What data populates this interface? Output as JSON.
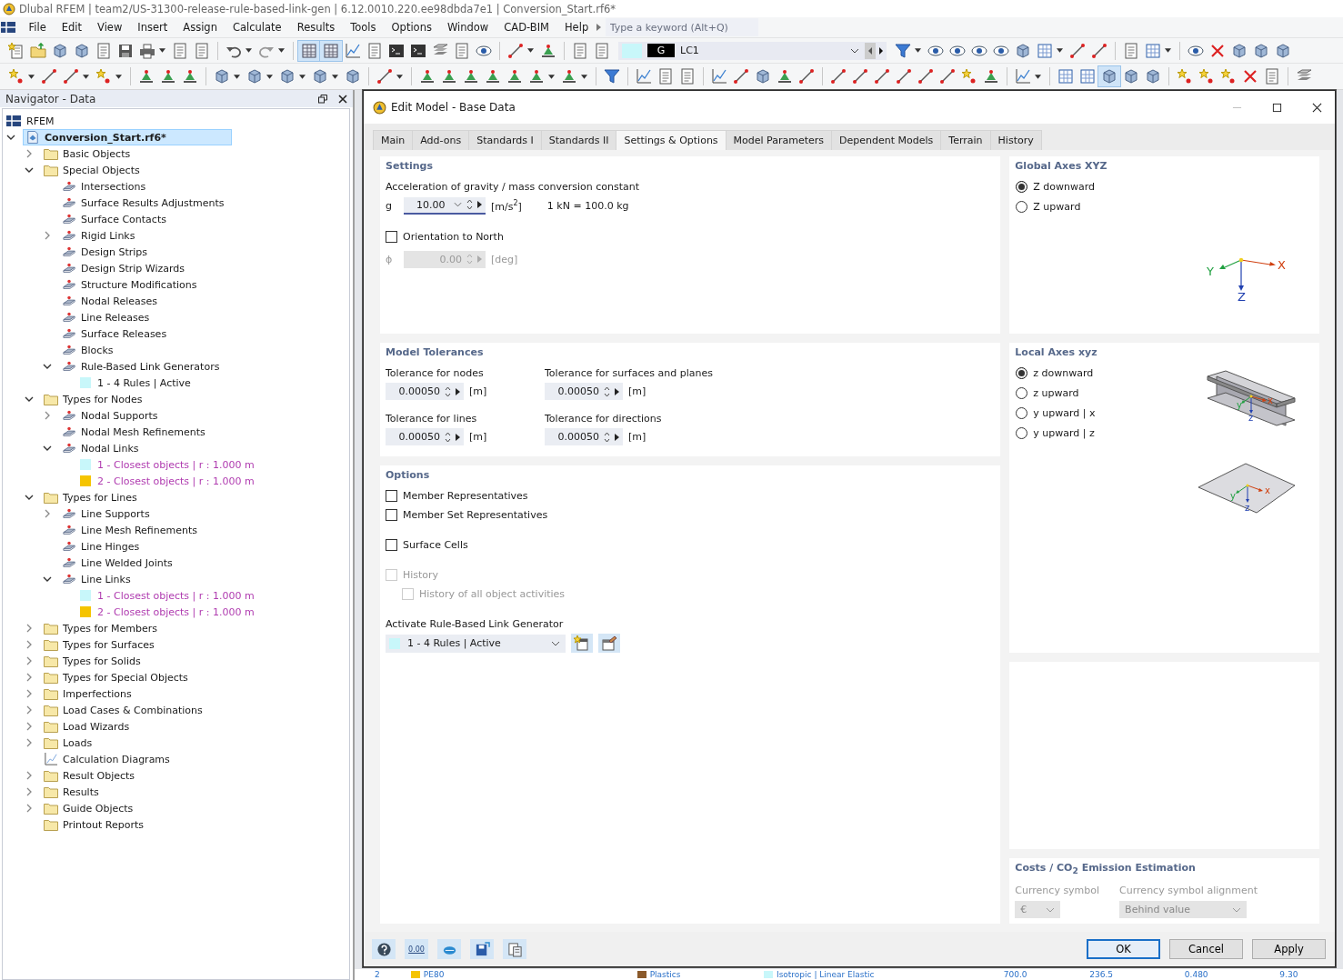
{
  "title_bar": {
    "title": "Dlubal RFEM | team2/US-31300-release-rule-based-link-gen | 6.12.0010.220.ee98dbda7e1 | Conversion_Start.rf6*"
  },
  "menu": [
    "File",
    "Edit",
    "View",
    "Insert",
    "Assign",
    "Calculate",
    "Results",
    "Tools",
    "Options",
    "Window",
    "CAD-BIM",
    "Help"
  ],
  "search": {
    "placeholder": "Type a keyword (Alt+Q)"
  },
  "load_case": {
    "category": "G",
    "name": "LC1"
  },
  "navigator": {
    "title": "Navigator - Data",
    "root": "RFEM",
    "tree": [
      {
        "label": "Conversion_Start.rf6*",
        "kind": "file",
        "selected": true,
        "expanded": true,
        "children": [
          {
            "label": "Basic Objects",
            "kind": "folder",
            "selected": false,
            "expanded": false
          },
          {
            "label": "Special Objects",
            "kind": "folder",
            "selected": false,
            "expanded": true,
            "children": [
              {
                "label": "Intersections",
                "kind": "object",
                "selected": false
              },
              {
                "label": "Surface Results Adjustments",
                "kind": "object",
                "selected": false
              },
              {
                "label": "Surface Contacts",
                "kind": "object",
                "selected": false
              },
              {
                "label": "Rigid Links",
                "kind": "object",
                "selected": false,
                "expanded": false
              },
              {
                "label": "Design Strips",
                "kind": "object",
                "selected": false
              },
              {
                "label": "Design Strip Wizards",
                "kind": "object",
                "selected": false
              },
              {
                "label": "Structure Modifications",
                "kind": "object",
                "selected": false
              },
              {
                "label": "Nodal Releases",
                "kind": "object",
                "selected": false
              },
              {
                "label": "Line Releases",
                "kind": "object",
                "selected": false
              },
              {
                "label": "Surface Releases",
                "kind": "object",
                "selected": false
              },
              {
                "label": "Blocks",
                "kind": "object",
                "selected": false
              },
              {
                "label": "Rule-Based Link Generators",
                "kind": "object",
                "selected": false,
                "expanded": true,
                "children": [
                  {
                    "label": "1 - 4 Rules | Active",
                    "kind": "rule",
                    "selected": false,
                    "color": "#c8f7fa"
                  }
                ]
              }
            ]
          },
          {
            "label": "Types for Nodes",
            "kind": "folder",
            "selected": false,
            "expanded": true,
            "children": [
              {
                "label": "Nodal Supports",
                "kind": "object",
                "selected": false,
                "expanded": false
              },
              {
                "label": "Nodal Mesh Refinements",
                "kind": "object",
                "selected": false
              },
              {
                "label": "Nodal Links",
                "kind": "object",
                "selected": false,
                "expanded": true,
                "children": [
                  {
                    "label": "1 - Closest objects | r : 1.000 m",
                    "kind": "link",
                    "selected": false,
                    "color": "#c8f7fa"
                  },
                  {
                    "label": "2 - Closest objects | r : 1.000 m",
                    "kind": "link",
                    "selected": false,
                    "color": "#f5c400"
                  }
                ]
              }
            ]
          },
          {
            "label": "Types for Lines",
            "kind": "folder",
            "selected": false,
            "expanded": true,
            "children": [
              {
                "label": "Line Supports",
                "kind": "object",
                "selected": false,
                "expanded": false
              },
              {
                "label": "Line Mesh Refinements",
                "kind": "object",
                "selected": false
              },
              {
                "label": "Line Hinges",
                "kind": "object",
                "selected": false
              },
              {
                "label": "Line Welded Joints",
                "kind": "object",
                "selected": false
              },
              {
                "label": "Line Links",
                "kind": "object",
                "selected": false,
                "expanded": true,
                "children": [
                  {
                    "label": "1 - Closest objects | r : 1.000 m",
                    "kind": "link",
                    "selected": false,
                    "color": "#c8f7fa"
                  },
                  {
                    "label": "2 - Closest objects | r : 1.000 m",
                    "kind": "link",
                    "selected": false,
                    "color": "#f5c400"
                  }
                ]
              }
            ]
          },
          {
            "label": "Types for Members",
            "kind": "folder",
            "selected": false,
            "expanded": false
          },
          {
            "label": "Types for Surfaces",
            "kind": "folder",
            "selected": false,
            "expanded": false
          },
          {
            "label": "Types for Solids",
            "kind": "folder",
            "selected": false,
            "expanded": false
          },
          {
            "label": "Types for Special Objects",
            "kind": "folder",
            "selected": false,
            "expanded": false
          },
          {
            "label": "Imperfections",
            "kind": "folder",
            "selected": false,
            "expanded": false
          },
          {
            "label": "Load Cases & Combinations",
            "kind": "folder",
            "selected": false,
            "expanded": false
          },
          {
            "label": "Load Wizards",
            "kind": "folder",
            "selected": false,
            "expanded": false
          },
          {
            "label": "Loads",
            "kind": "folder",
            "selected": false,
            "expanded": false
          },
          {
            "label": "Calculation Diagrams",
            "kind": "diagram",
            "selected": false
          },
          {
            "label": "Result Objects",
            "kind": "folder",
            "selected": false,
            "expanded": false
          },
          {
            "label": "Results",
            "kind": "folder",
            "selected": false,
            "expanded": false
          },
          {
            "label": "Guide Objects",
            "kind": "folder",
            "selected": false,
            "expanded": false
          },
          {
            "label": "Printout Reports",
            "kind": "folder",
            "selected": false
          }
        ]
      }
    ]
  },
  "dialog": {
    "title": "Edit Model - Base Data",
    "tabs": [
      {
        "label": "Main",
        "selected": false
      },
      {
        "label": "Add-ons",
        "selected": false
      },
      {
        "label": "Standards I",
        "selected": false
      },
      {
        "label": "Standards II",
        "selected": false
      },
      {
        "label": "Settings & Options",
        "selected": true
      },
      {
        "label": "Model Parameters",
        "selected": false
      },
      {
        "label": "Dependent Models",
        "selected": false
      },
      {
        "label": "Terrain",
        "selected": false
      },
      {
        "label": "History",
        "selected": false
      }
    ],
    "settings": {
      "title": "Settings",
      "gravity_label": "Acceleration of gravity / mass conversion constant",
      "gravity_symbol": "g",
      "gravity_value": "10.00",
      "gravity_unit": "[m/s$^{2}$]",
      "conversion": "1 kN = 100.0 kg",
      "orientation": {
        "label": "Orientation to North",
        "checked": false
      },
      "angle": {
        "symbol": "ϕ",
        "value": "0.00",
        "unit": "[deg]",
        "disabled": true
      }
    },
    "tolerances": {
      "title": "Model Tolerances",
      "fields": [
        {
          "label": "Tolerance for nodes",
          "value": "0.00050",
          "unit": "[m]"
        },
        {
          "label": "Tolerance for surfaces and planes",
          "value": "0.00050",
          "unit": "[m]"
        },
        {
          "label": "Tolerance for lines",
          "value": "0.00050",
          "unit": "[m]"
        },
        {
          "label": "Tolerance for directions",
          "value": "0.00050",
          "unit": "[m]"
        }
      ]
    },
    "options": {
      "title": "Options",
      "checkboxes": [
        {
          "label": "Member Representatives",
          "checked": false,
          "disabled": false
        },
        {
          "label": "Member Set Representatives",
          "checked": false,
          "disabled": false
        },
        {
          "label": "Surface Cells",
          "checked": false,
          "disabled": false
        },
        {
          "label": "History",
          "checked": false,
          "disabled": true,
          "children": [
            {
              "label": "History of all object activities",
              "checked": false,
              "disabled": true
            }
          ]
        }
      ],
      "generator_label": "Activate Rule-Based Link Generator",
      "generator": {
        "value": "1 - 4 Rules | Active",
        "color": "#c8f7fa"
      }
    },
    "global_axes": {
      "title": "Global Axes XYZ",
      "options": [
        {
          "label": "Z downward",
          "selected": true
        },
        {
          "label": "Z upward",
          "selected": false
        }
      ],
      "axis_labels": [
        "X",
        "Y",
        "Z"
      ]
    },
    "local_axes": {
      "title": "Local Axes xyz",
      "options": [
        {
          "label": "z downward",
          "selected": true
        },
        {
          "label": "z upward",
          "selected": false
        },
        {
          "label": "y upward | x",
          "selected": false
        },
        {
          "label": "y upward | z",
          "selected": false
        }
      ],
      "beam_axis_labels": [
        "x",
        "y",
        "z"
      ],
      "plate_axis_labels": [
        "x",
        "y",
        "z"
      ]
    },
    "costs": {
      "title": "Costs / CO$_{2}$ Emission Estimation",
      "currency_label": "Currency symbol",
      "currency": "€",
      "alignment_label": "Currency symbol alignment",
      "alignment": "Behind value",
      "disabled": true
    },
    "units_button_text": "0.00",
    "buttons": [
      {
        "label": "OK",
        "kind": "default"
      },
      {
        "label": "Cancel",
        "kind": "normal"
      },
      {
        "label": "Apply",
        "kind": "normal"
      }
    ]
  },
  "table_row": {
    "cells": [
      {
        "text": "2"
      },
      {
        "text": "PE80",
        "color": "#f5c400"
      },
      {
        "text": "Plastics",
        "color": "#8b5a2b"
      },
      {
        "text": "Isotropic | Linear Elastic",
        "color": "#c8f7fa"
      },
      {
        "text": "700.0"
      },
      {
        "text": "236.5"
      },
      {
        "text": "0.480"
      },
      {
        "text": "9.30"
      }
    ]
  }
}
